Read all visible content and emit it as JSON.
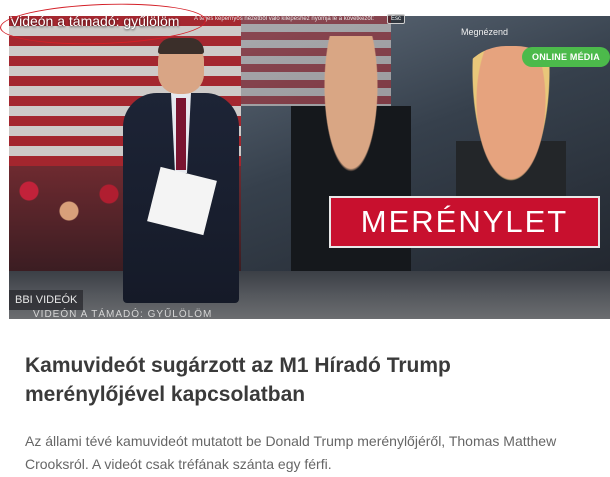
{
  "video": {
    "title": "Videón a támadó: gyűlölöm",
    "fullscreen_hint": "A teljes képernyős nézetből való kilépéshez nyomja le a következőt:",
    "esc_key": "Esc",
    "top_right_text": "Megnézend",
    "badge": "ONLINE MÉDIA",
    "banner_text": "MERÉNYLET",
    "source_tag": "BBI VIDEÓK",
    "lower_third": "VIDEÓN A TÁMADÓ: GYŰLÖLÖM"
  },
  "article": {
    "headline": "Kamuvideót sugárzott az M1 Híradó Trump merénylőjével kapcsolatban",
    "lead": "Az állami tévé kamuvideót mutatott be Donald Trump merénylőjéről, Thomas Matthew Crooksról. A videót csak tréfának szánta egy férfi."
  },
  "colors": {
    "badge_green": "#4cba4b",
    "banner_red": "#c8102e",
    "annotation_red": "#d42028",
    "headline": "#3a3a3a",
    "lead": "#666666"
  }
}
